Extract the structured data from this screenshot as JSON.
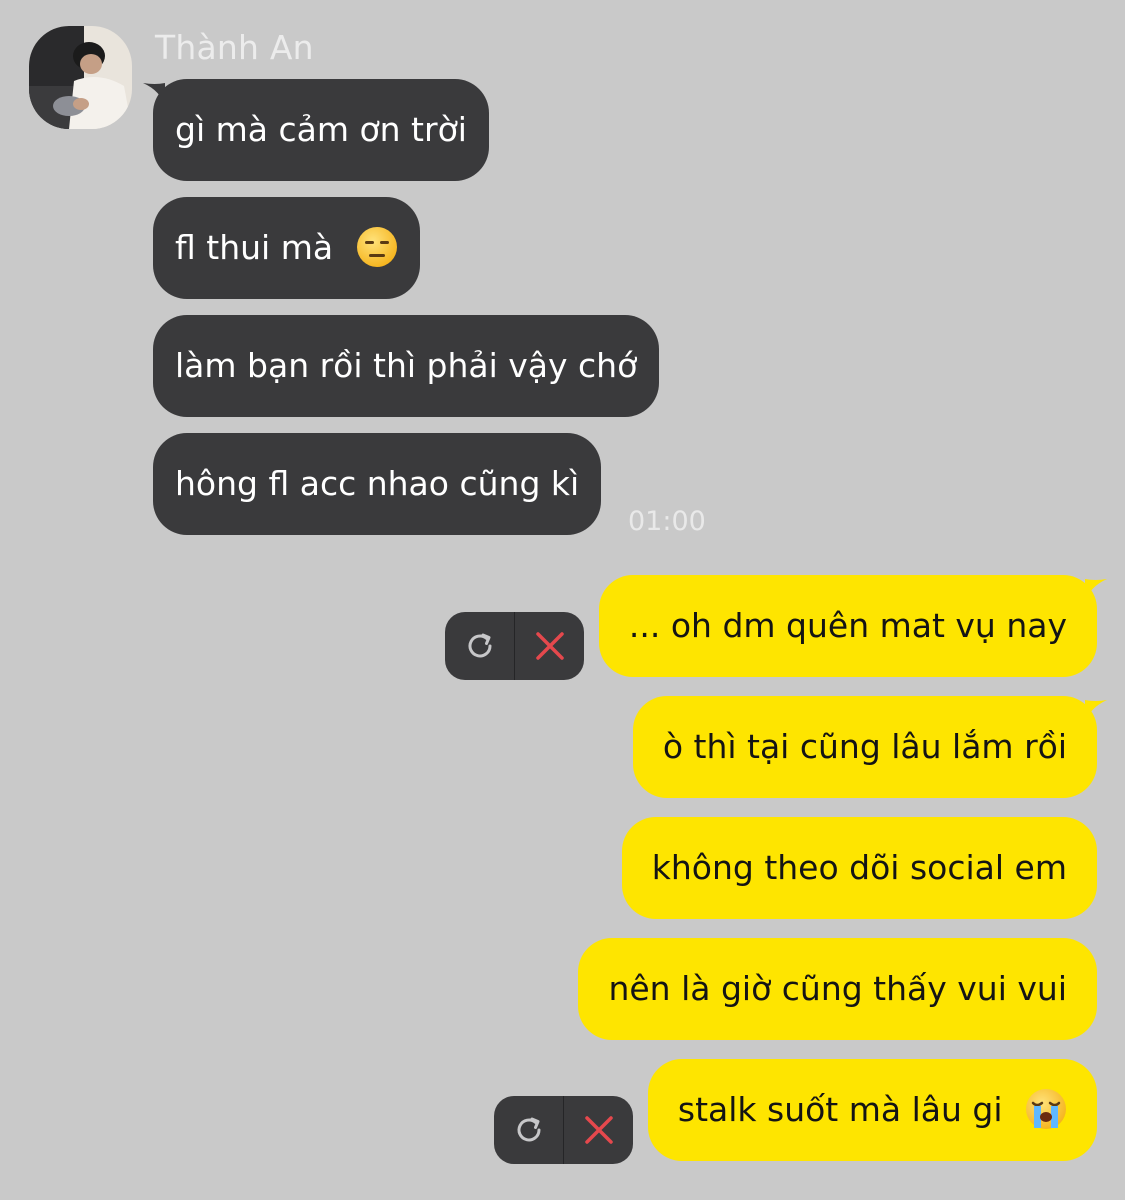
{
  "conversation": {
    "contact": {
      "name": "Thành An"
    },
    "incoming": [
      {
        "text": "gì mà cảm ơn trời",
        "emoji": ""
      },
      {
        "text": "fl thui mà",
        "emoji": "expressionless-face-icon"
      },
      {
        "text": "làm bạn rồi thì phải vậy chớ",
        "emoji": ""
      },
      {
        "text": "hông fl acc nhao cũng kì",
        "emoji": ""
      }
    ],
    "incoming_time": "01:00",
    "outgoing": [
      {
        "text": "... oh dm quên mat vụ nay",
        "emoji": "",
        "status": "failed"
      },
      {
        "text": "ò thì tại cũng lâu lắm rồi",
        "emoji": ""
      },
      {
        "text": "không theo dõi social em",
        "emoji": ""
      },
      {
        "text": "nên là giờ cũng thấy vui vui",
        "emoji": ""
      },
      {
        "text": "stalk suốt mà lâu gi",
        "emoji": "loudly-crying-face-icon",
        "status": "failed"
      }
    ],
    "failed_actions": {
      "retry_icon": "retry-icon",
      "delete_icon": "close-icon"
    }
  },
  "colors": {
    "background": "#c9c9c9",
    "incoming_bubble": "#3a3a3c",
    "outgoing_bubble": "#fee500",
    "delete_red": "#e5484d"
  }
}
